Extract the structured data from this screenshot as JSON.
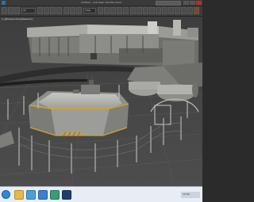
{
  "window": {
    "title": "Untitled - Autodesk 3ds Max 2014",
    "help_search": ""
  },
  "toolbar": {
    "selection_filter": "All",
    "view_dropdown": "View"
  },
  "viewport": {
    "label_left": "[+][Perspective][Realistic]",
    "label_right": ""
  },
  "taskbar": {
    "apps": [
      "start",
      "explorer",
      "media",
      "browser",
      "3dsmax",
      "photoshop"
    ],
    "clock": "12:00"
  },
  "colors": {
    "accent": "#2e8ad8",
    "titlebar": "#3a3a3a",
    "viewport_bg": "#4a4a4a",
    "concrete": "#b9bab5",
    "warning_stripe": "#d8a428"
  }
}
